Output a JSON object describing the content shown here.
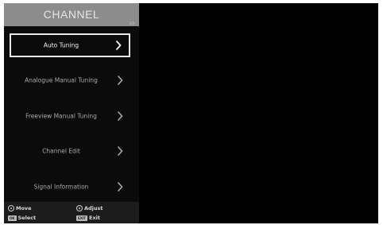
{
  "menu": {
    "title": "CHANNEL",
    "page_indicator": "1/3",
    "items": [
      {
        "label": "Auto Tuning",
        "selected": true
      },
      {
        "label": "Analogue Manual Tuning",
        "selected": false
      },
      {
        "label": "Freeview Manual Tuning",
        "selected": false
      },
      {
        "label": "Channel Edit",
        "selected": false
      },
      {
        "label": "Signal Information",
        "selected": false
      }
    ]
  },
  "footer": {
    "move_label": "Move",
    "adjust_label": "Adjust",
    "select_label": "Select",
    "exit_label": "Exit",
    "ok_key": "OK",
    "exit_key": "EXIT"
  },
  "colors": {
    "header_bg": "#8c8c8c",
    "panel_bg": "#0b0b0b",
    "selection_border": "#e8e8e8",
    "item_text": "#a8a8a8"
  },
  "icons": {
    "item_arrow": "chevron-right-icon",
    "move": "navigation-pad-icon",
    "adjust": "left-right-pad-icon"
  }
}
